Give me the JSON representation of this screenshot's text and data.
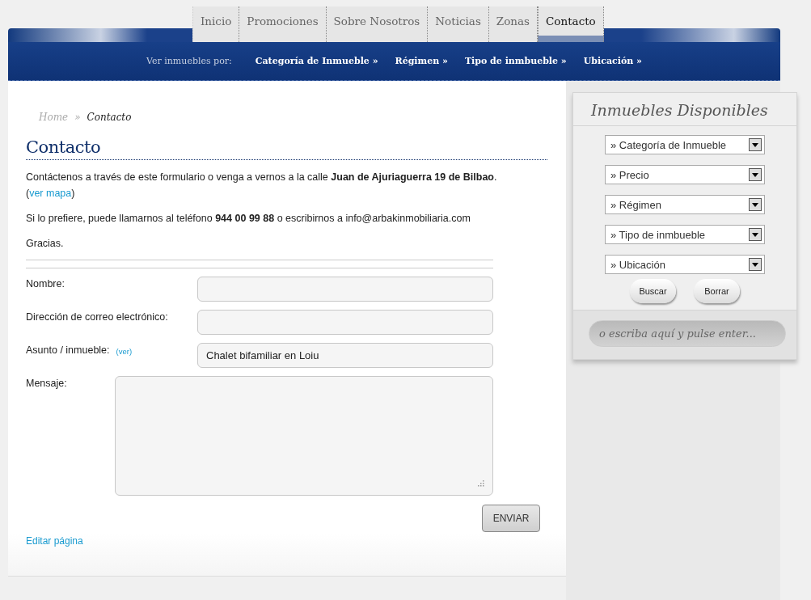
{
  "top_tabs": [
    {
      "label": "Inicio",
      "selected": false
    },
    {
      "label": "Promociones",
      "selected": false
    },
    {
      "label": "Sobre Nosotros",
      "selected": false
    },
    {
      "label": "Noticias",
      "selected": false
    },
    {
      "label": "Zonas",
      "selected": false
    },
    {
      "label": "Contacto",
      "selected": true
    }
  ],
  "subnav": {
    "label": "Ver inmuebles por:",
    "items": [
      "Categoría de Inmueble »",
      "Régimen »",
      "Tipo de inmbueble »",
      "Ubicación »"
    ]
  },
  "breadcrumb": {
    "home": "Home",
    "separator": "»",
    "current": "Contacto"
  },
  "heading": "Contacto",
  "intro": [
    {
      "text": "Contáctenos a través de este formulario o venga a vernos a la calle **Juan de Ajuriaguerra 19 de Bilbao**.",
      "before": "(",
      "link": "ver mapa",
      "after": ")"
    },
    {
      "text": "Si lo prefiere, puede llamarnos al teléfono **944 00 99 88** o escribirnos a info@arbakinmobiliaria.com"
    },
    {
      "text": "Gracias."
    }
  ],
  "form": [
    {
      "kind": "input",
      "label": "Nombre:"
    },
    {
      "kind": "input",
      "label": "Dirección de correo electrónico:"
    },
    {
      "kind": "input",
      "label": "Asunto / inmueble:",
      "link": "(ver)",
      "value": "Chalet bifamiliar en Loiu"
    },
    {
      "kind": "textarea",
      "label": "Mensaje:"
    }
  ],
  "submit": "ENVIAR",
  "edit_link": "Editar página",
  "sidebar": {
    "title": "Inmuebles Disponibles",
    "selects": [
      "» Categoría de Inmueble",
      "» Precio",
      "» Régimen",
      "» Tipo de inmbueble",
      "» Ubicación"
    ],
    "buttons": [
      "Buscar",
      "Borrar"
    ],
    "search": {
      "placeholder": "o escriba aquí y pulse enter..."
    }
  }
}
